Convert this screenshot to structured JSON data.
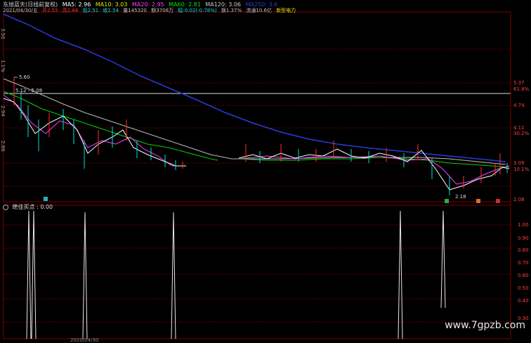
{
  "header": {
    "stock_name": "东旭蓝天(日线前复权)",
    "ma5": "MA5: 2.96",
    "ma10": "MA10: 3.03",
    "ma20": "MA20: 2.95",
    "ma60": "MA60: 2.81",
    "ma120": "MA120: 3.06",
    "ma250": "MA250: 3.6"
  },
  "quote": {
    "date": "2021/04/30/五",
    "open": "开2.55",
    "high": "高2.68",
    "low": "低2.51",
    "close": "收2.54",
    "volume": "量145320",
    "amount": "额3708万",
    "change": "幅-0.02(-0.78%)",
    "turnover": "换1.37%",
    "float_cap": "流通10.6亿",
    "concept": "新型电力"
  },
  "price_axis": [
    "5.37",
    "61.8%",
    "4.74",
    "4.11",
    "30.2%",
    "3.09",
    "10.1%",
    "2.08"
  ],
  "price_marks": {
    "high_mark": "5.60",
    "range_mark": "5.12 - 5.08",
    "low_mark": "2.18"
  },
  "indicator": {
    "name": "绝佳买点",
    "value": ": 0.00",
    "axis": [
      "1.00",
      "0.90",
      "0.80",
      "0.70",
      "0.60",
      "0.50",
      "0.40",
      "0.30"
    ]
  },
  "left_axis": [
    "3.50",
    "1.1%",
    "2.94",
    "2.86"
  ],
  "bottom_axis": [
    "2020/04/30"
  ],
  "watermark": "www.7gpzb.com",
  "colors": {
    "ma5": "#ffffff",
    "ma10": "#e6e600",
    "ma20": "#ff40ff",
    "ma60": "#00e600",
    "ma120": "#cccccc",
    "ma250": "#2a3bd8",
    "up": "#ff3030",
    "down": "#00e0e0",
    "grid": "#700000"
  }
}
